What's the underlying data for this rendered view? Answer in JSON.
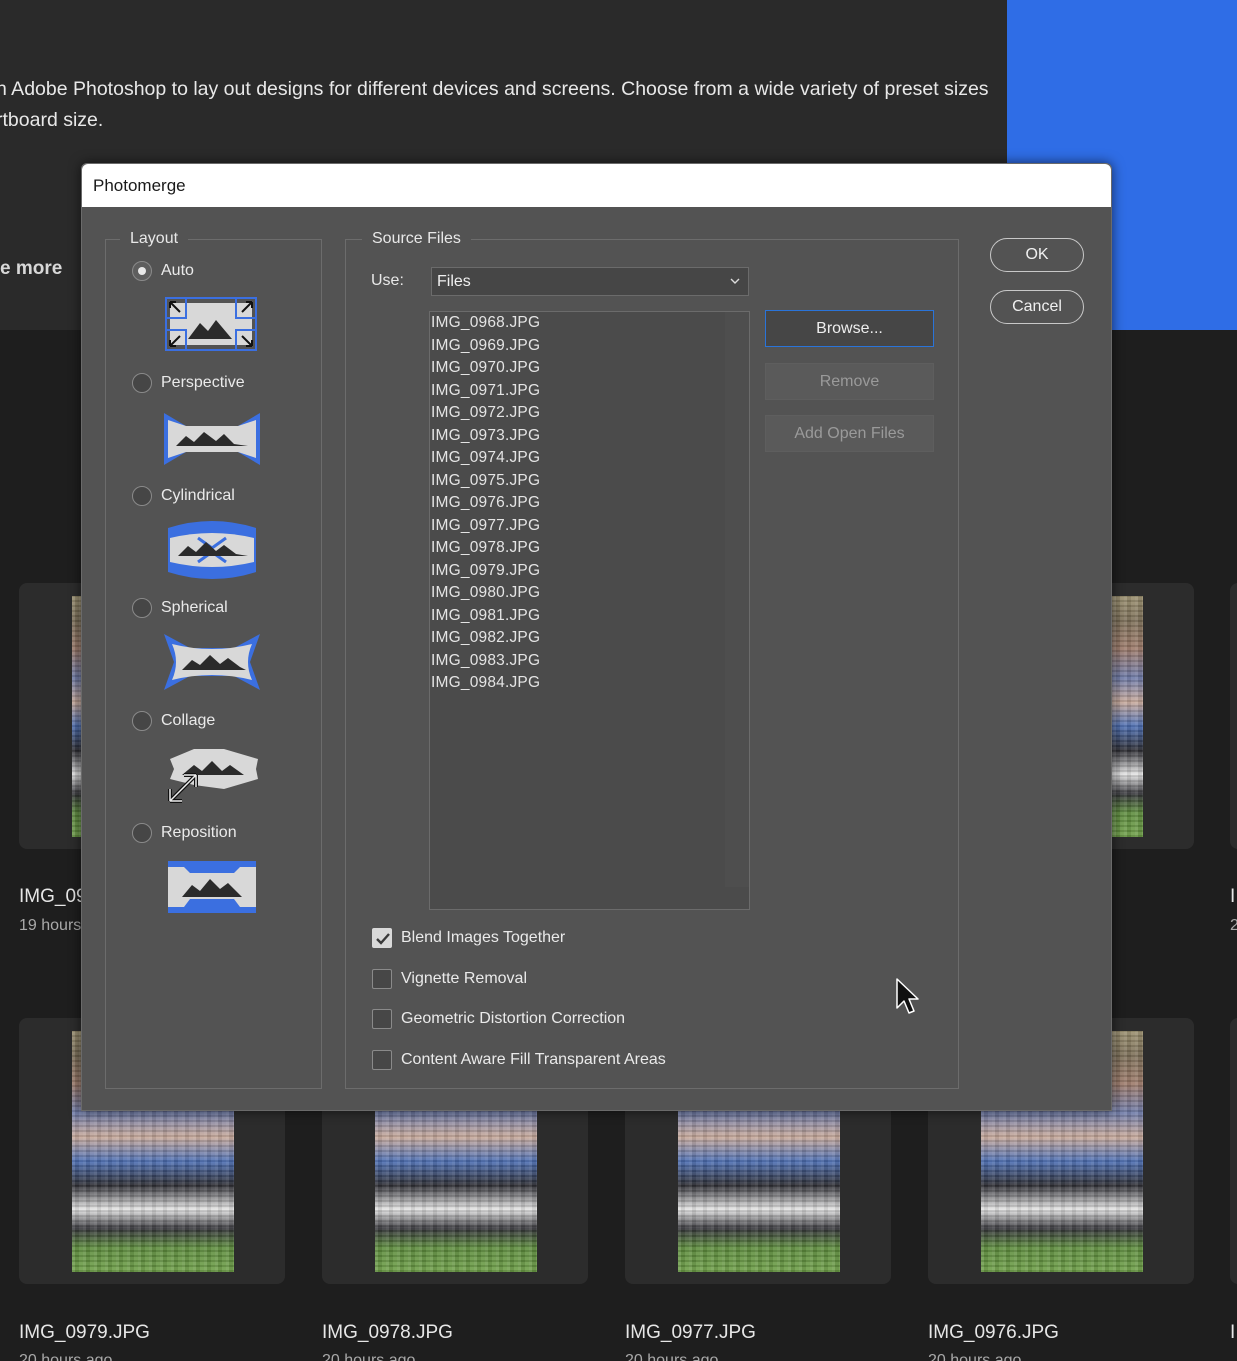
{
  "background": {
    "description_lines": [
      "n Adobe Photoshop to lay out designs for different devices and screens. Choose from a wide variety of preset sizes",
      "rtboard size."
    ],
    "learn_more": "e more",
    "partial_cards": [
      {
        "name": "IMG_09",
        "time": "19 hours"
      }
    ],
    "cards": [
      {
        "name": "IMG_0979.JPG",
        "time": "20 hours ago"
      },
      {
        "name": "IMG_0978.JPG",
        "time": "20 hours ago"
      },
      {
        "name": "IMG_0977.JPG",
        "time": "20 hours ago"
      },
      {
        "name": "IMG_0976.JPG",
        "time": "20 hours ago"
      }
    ],
    "right_edge_initials": [
      "I",
      "2",
      "I"
    ],
    "accent_color": "#2f6de6"
  },
  "dialog": {
    "title": "Photomerge",
    "layout": {
      "legend": "Layout",
      "selected": "Auto",
      "options": [
        {
          "label": "Auto",
          "icon": "auto-layout-icon"
        },
        {
          "label": "Perspective",
          "icon": "perspective-layout-icon"
        },
        {
          "label": "Cylindrical",
          "icon": "cylindrical-layout-icon"
        },
        {
          "label": "Spherical",
          "icon": "spherical-layout-icon"
        },
        {
          "label": "Collage",
          "icon": "collage-layout-icon"
        },
        {
          "label": "Reposition",
          "icon": "reposition-layout-icon"
        }
      ]
    },
    "source_files": {
      "legend": "Source Files",
      "use_label": "Use:",
      "use_value": "Files",
      "files": [
        "IMG_0968.JPG",
        "IMG_0969.JPG",
        "IMG_0970.JPG",
        "IMG_0971.JPG",
        "IMG_0972.JPG",
        "IMG_0973.JPG",
        "IMG_0974.JPG",
        "IMG_0975.JPG",
        "IMG_0976.JPG",
        "IMG_0977.JPG",
        "IMG_0978.JPG",
        "IMG_0979.JPG",
        "IMG_0980.JPG",
        "IMG_0981.JPG",
        "IMG_0982.JPG",
        "IMG_0983.JPG",
        "IMG_0984.JPG"
      ],
      "browse_label": "Browse...",
      "remove_label": "Remove",
      "add_open_files_label": "Add Open Files"
    },
    "options": {
      "blend_images": {
        "label": "Blend Images Together",
        "checked": true
      },
      "vignette_removal": {
        "label": "Vignette Removal",
        "checked": false
      },
      "geometric_distortion": {
        "label": "Geometric Distortion Correction",
        "checked": false
      },
      "content_aware_fill": {
        "label": "Content Aware Fill Transparent Areas",
        "checked": false
      }
    },
    "ok_label": "OK",
    "cancel_label": "Cancel",
    "icon_accent": "#3b6fe0"
  }
}
